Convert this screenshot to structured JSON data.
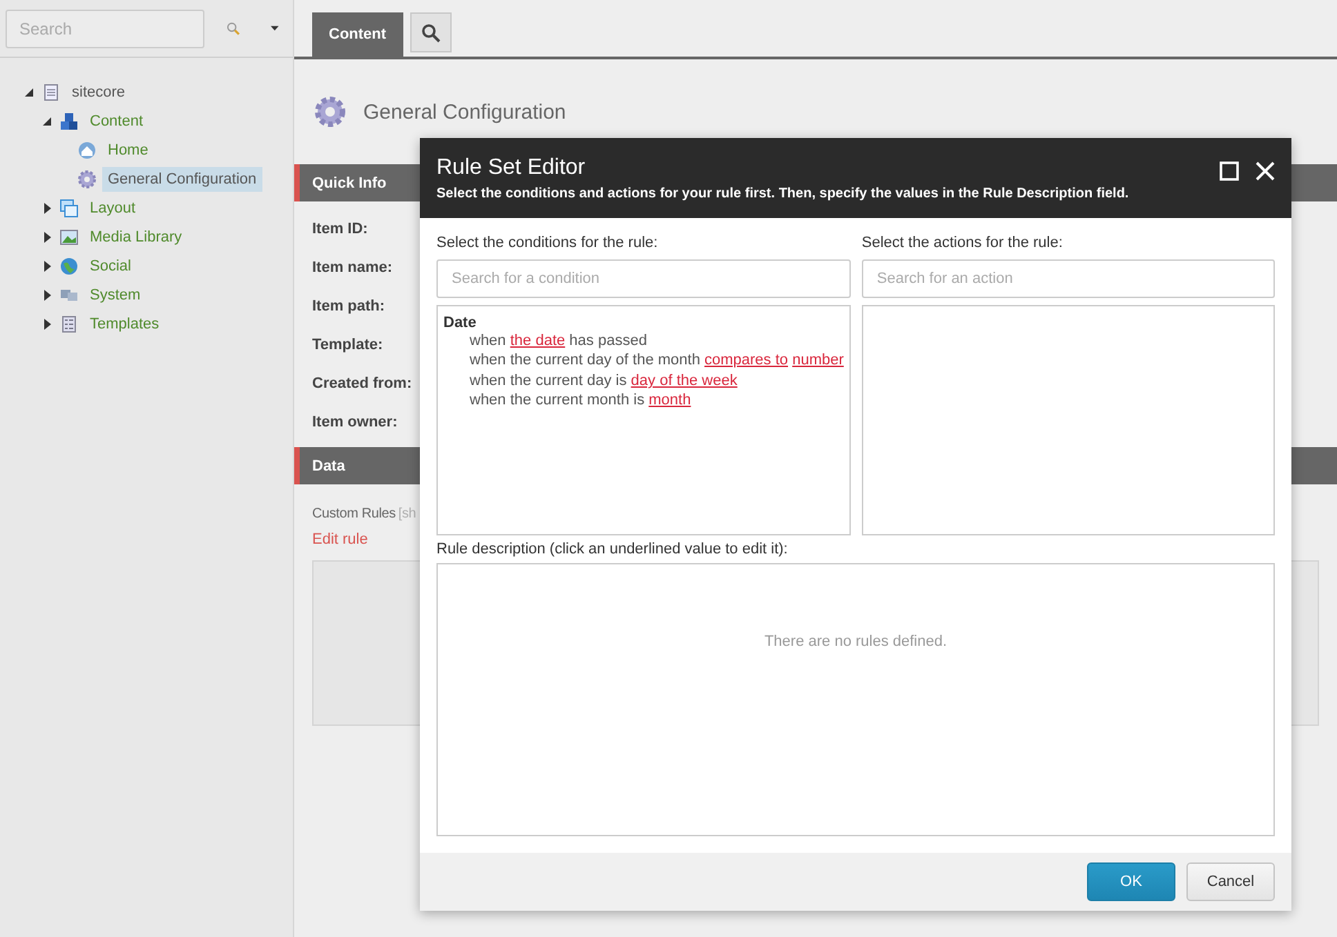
{
  "sidebar": {
    "search": {
      "placeholder": "Search"
    },
    "tree": [
      {
        "label": "sitecore",
        "kind": "document",
        "expanded": true,
        "selected": false,
        "children": [
          {
            "label": "Content",
            "kind": "content",
            "expanded": true,
            "selected": false,
            "children": [
              {
                "label": "Home",
                "kind": "home",
                "selected": false
              },
              {
                "label": "General Configuration",
                "kind": "gear",
                "selected": true
              }
            ]
          },
          {
            "label": "Layout",
            "kind": "layout",
            "expanded": false,
            "selected": false
          },
          {
            "label": "Media Library",
            "kind": "media",
            "expanded": false,
            "selected": false
          },
          {
            "label": "Social",
            "kind": "globe",
            "expanded": false,
            "selected": false
          },
          {
            "label": "System",
            "kind": "system",
            "expanded": false,
            "selected": false
          },
          {
            "label": "Templates",
            "kind": "template",
            "expanded": false,
            "selected": false
          }
        ]
      }
    ]
  },
  "tabs": [
    {
      "label": "Content",
      "selected": true
    }
  ],
  "item": {
    "title": "General Configuration",
    "sections": [
      {
        "title": "Quick Info",
        "fields": [
          "Item ID:",
          "Item name:",
          "Item path:",
          "Template:",
          "Created from:",
          "Item owner:"
        ]
      },
      {
        "title": "Data",
        "field_label": "Custom Rules",
        "field_hint": "[sh",
        "link": "Edit rule"
      }
    ]
  },
  "dialog": {
    "title": "Rule Set Editor",
    "subtitle": "Select the conditions and actions for your rule first. Then, specify the values in the Rule Description field.",
    "conditions": {
      "label": "Select the conditions for the rule:",
      "placeholder": "Search for a condition",
      "group": "Date",
      "items": [
        [
          {
            "text": "when ",
            "link": false
          },
          {
            "text": "the date",
            "link": true
          },
          {
            "text": " has passed",
            "link": false
          }
        ],
        [
          {
            "text": "when the current day of the month ",
            "link": false
          },
          {
            "text": "compares to",
            "link": true
          },
          {
            "text": "number",
            "link": true
          }
        ],
        [
          {
            "text": "when the current day is ",
            "link": false
          },
          {
            "text": "day of the week",
            "link": true
          }
        ],
        [
          {
            "text": "when the current month is ",
            "link": false
          },
          {
            "text": "month",
            "link": true
          }
        ]
      ]
    },
    "actions": {
      "label": "Select the actions for the rule:",
      "placeholder": "Search for an action"
    },
    "description": {
      "label": "Rule description (click an underlined value to edit it):",
      "empty": "There are no rules defined."
    },
    "buttons": [
      {
        "label": "OK",
        "kind": "primary"
      },
      {
        "label": "Cancel",
        "kind": "secondary"
      }
    ]
  }
}
